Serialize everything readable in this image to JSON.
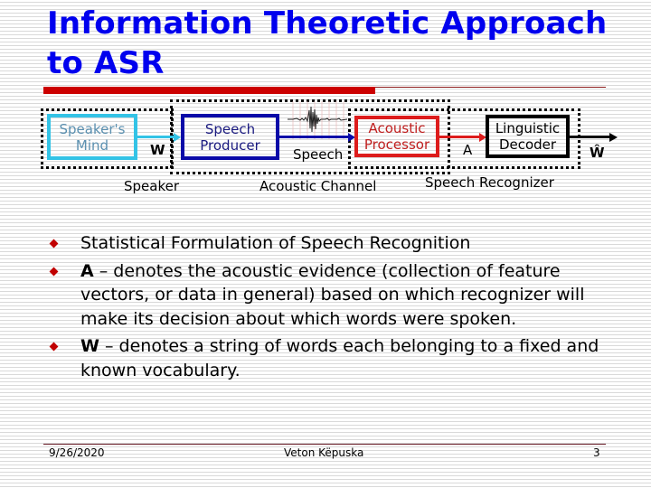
{
  "slide": {
    "title": "Information Theoretic Approach to ASR",
    "title_line1": "Information Theoretic Approach",
    "title_line2": "to ASR"
  },
  "diagram": {
    "groups": {
      "speaker": "Speaker",
      "acoustic_channel": "Acoustic Channel",
      "speech_recognizer": "Speech Recognizer"
    },
    "blocks": {
      "speakers_mind": [
        "Speaker's",
        "Mind"
      ],
      "speech_producer": [
        "Speech",
        "Producer"
      ],
      "acoustic_processor": [
        "Acoustic",
        "Processor"
      ],
      "linguistic_decoder": [
        "Linguistic",
        "Decoder"
      ]
    },
    "signals": {
      "w": "W",
      "speech": "Speech",
      "a": "A",
      "w_hat": "Ŵ"
    },
    "colors": {
      "speakers_mind": "#33c3e6",
      "speech_producer": "#0a0aa8",
      "acoustic_processor": "#dd1c1c",
      "linguistic_decoder": "#000000"
    },
    "icons": {
      "waveform": "speech-waveform-icon"
    }
  },
  "bullets": [
    {
      "bold": "",
      "text": "Statistical Formulation of Speech Recognition"
    },
    {
      "bold": "A",
      "text": " – denotes the acoustic evidence (collection of feature vectors, or data in general) based on which recognizer will make its decision about which words were spoken."
    },
    {
      "bold": "W",
      "text": " – denotes a string of words each belonging to a fixed and known vocabulary."
    }
  ],
  "footer": {
    "date": "9/26/2020",
    "author": "Veton Këpuska",
    "page": "3"
  }
}
